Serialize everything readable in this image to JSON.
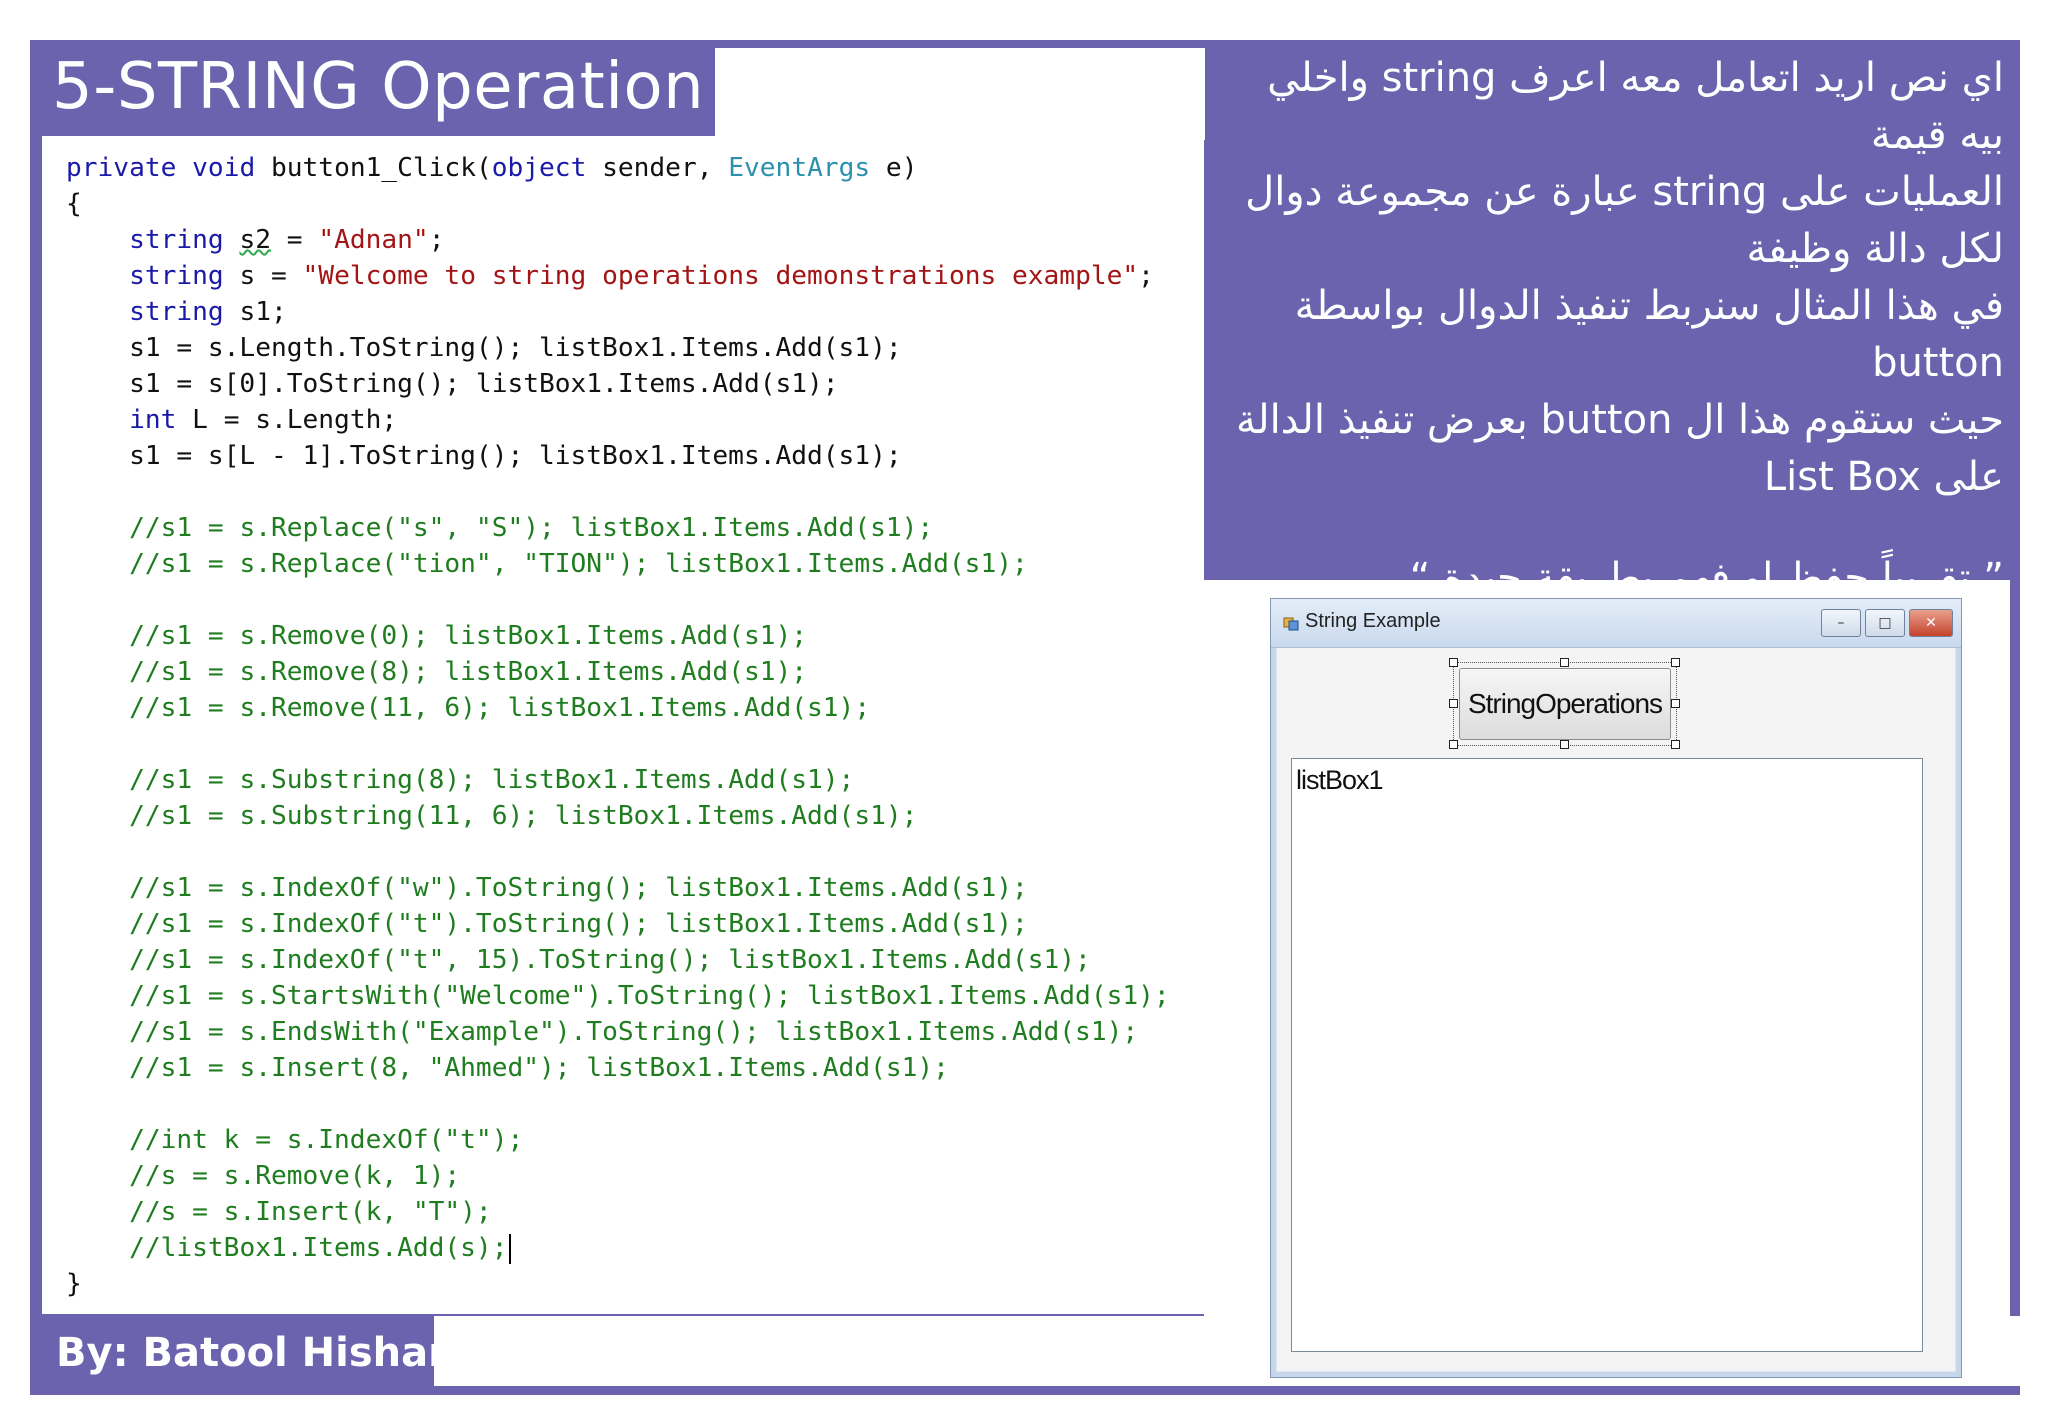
{
  "slide": {
    "title": "5-STRING Operation",
    "author": "By: Batool Hisham"
  },
  "code": {
    "lines": [
      [
        {
          "c": "kw",
          "t": "private"
        },
        {
          "t": " "
        },
        {
          "c": "kw",
          "t": "void"
        },
        {
          "t": " button1_Click("
        },
        {
          "c": "kw",
          "t": "object"
        },
        {
          "t": " sender, "
        },
        {
          "c": "ty",
          "t": "EventArgs"
        },
        {
          "t": " e)"
        }
      ],
      [
        {
          "t": "{"
        }
      ],
      [
        {
          "t": "    "
        },
        {
          "c": "kw",
          "t": "string"
        },
        {
          "t": " "
        },
        {
          "c": "squig",
          "t": "s2"
        },
        {
          "t": " = "
        },
        {
          "c": "st",
          "t": "\"Adnan\""
        },
        {
          "t": ";"
        }
      ],
      [
        {
          "t": "    "
        },
        {
          "c": "kw",
          "t": "string"
        },
        {
          "t": " s = "
        },
        {
          "c": "st",
          "t": "\"Welcome to string operations demonstrations example\""
        },
        {
          "t": ";"
        }
      ],
      [
        {
          "t": "    "
        },
        {
          "c": "kw",
          "t": "string"
        },
        {
          "t": " s1;"
        }
      ],
      [
        {
          "t": "    s1 = s.Length.ToString(); listBox1.Items.Add(s1);"
        }
      ],
      [
        {
          "t": "    s1 = s[0].ToString(); listBox1.Items.Add(s1);"
        }
      ],
      [
        {
          "t": "    "
        },
        {
          "c": "kw",
          "t": "int"
        },
        {
          "t": " L = s.Length;"
        }
      ],
      [
        {
          "t": "    s1 = s[L - 1].ToString(); listBox1.Items.Add(s1);"
        }
      ],
      [],
      [
        {
          "t": "    "
        },
        {
          "c": "cm",
          "t": "//s1 = s.Replace(\"s\", \"S\"); listBox1.Items.Add(s1);"
        }
      ],
      [
        {
          "t": "    "
        },
        {
          "c": "cm",
          "t": "//s1 = s.Replace(\"tion\", \"TION\"); listBox1.Items.Add(s1);"
        }
      ],
      [],
      [
        {
          "t": "    "
        },
        {
          "c": "cm",
          "t": "//s1 = s.Remove(0); listBox1.Items.Add(s1);"
        }
      ],
      [
        {
          "t": "    "
        },
        {
          "c": "cm",
          "t": "//s1 = s.Remove(8); listBox1.Items.Add(s1);"
        }
      ],
      [
        {
          "t": "    "
        },
        {
          "c": "cm",
          "t": "//s1 = s.Remove(11, 6); listBox1.Items.Add(s1);"
        }
      ],
      [],
      [
        {
          "t": "    "
        },
        {
          "c": "cm",
          "t": "//s1 = s.Substring(8); listBox1.Items.Add(s1);"
        }
      ],
      [
        {
          "t": "    "
        },
        {
          "c": "cm",
          "t": "//s1 = s.Substring(11, 6); listBox1.Items.Add(s1);"
        }
      ],
      [],
      [
        {
          "t": "    "
        },
        {
          "c": "cm",
          "t": "//s1 = s.IndexOf(\"w\").ToString(); listBox1.Items.Add(s1);"
        }
      ],
      [
        {
          "t": "    "
        },
        {
          "c": "cm",
          "t": "//s1 = s.IndexOf(\"t\").ToString(); listBox1.Items.Add(s1);"
        }
      ],
      [
        {
          "t": "    "
        },
        {
          "c": "cm",
          "t": "//s1 = s.IndexOf(\"t\", 15).ToString(); listBox1.Items.Add(s1);"
        }
      ],
      [
        {
          "t": "    "
        },
        {
          "c": "cm",
          "t": "//s1 = s.StartsWith(\"Welcome\").ToString(); listBox1.Items.Add(s1);"
        }
      ],
      [
        {
          "t": "    "
        },
        {
          "c": "cm",
          "t": "//s1 = s.EndsWith(\"Example\").ToString(); listBox1.Items.Add(s1);"
        }
      ],
      [
        {
          "t": "    "
        },
        {
          "c": "cm",
          "t": "//s1 = s.Insert(8, \"Ahmed\"); listBox1.Items.Add(s1);"
        }
      ],
      [],
      [
        {
          "t": "    "
        },
        {
          "c": "cm",
          "t": "//int k = s.IndexOf(\"t\");"
        }
      ],
      [
        {
          "t": "    "
        },
        {
          "c": "cm",
          "t": "//s = s.Remove(k, 1);"
        }
      ],
      [
        {
          "t": "    "
        },
        {
          "c": "cm",
          "t": "//s = s.Insert(k, \"T\");"
        }
      ],
      [
        {
          "t": "    "
        },
        {
          "c": "cm",
          "t": "//listBox1.Items.Add(s);"
        },
        {
          "c": "caret",
          "t": ""
        }
      ],
      [
        {
          "t": "}"
        }
      ]
    ]
  },
  "notes": {
    "line1": "اي نص اريد اتعامل معه اعرف string واخلي",
    "line2": "بيه قيمة",
    "line3": "العمليات على string عبارة عن مجموعة دوال",
    "line4": "لكل دالة وظيفة",
    "line5": "في هذا المثال سنربط تنفيذ الدوال بواسطة button",
    "line6": "حيث ستقوم هذا ال button بعرض تنفيذ الدالة",
    "line7": "على List Box",
    "line8": "” تقريباً حفظ او فهم بطريقة جيدة “"
  },
  "form": {
    "window_title": "String Example",
    "minimize_glyph": "–",
    "maximize_glyph": "□",
    "close_glyph": "✕",
    "button_label": "StringOperations",
    "listbox_label": "listBox1"
  },
  "colors": {
    "frame": "#6b63ad",
    "keyword": "#1a1aa8",
    "type": "#2b91af",
    "string": "#a31515",
    "comment": "#1f7d1f"
  },
  "icons": {
    "app": "form-app-icon",
    "minimize": "minimize-icon",
    "maximize": "maximize-icon",
    "close": "close-icon"
  }
}
